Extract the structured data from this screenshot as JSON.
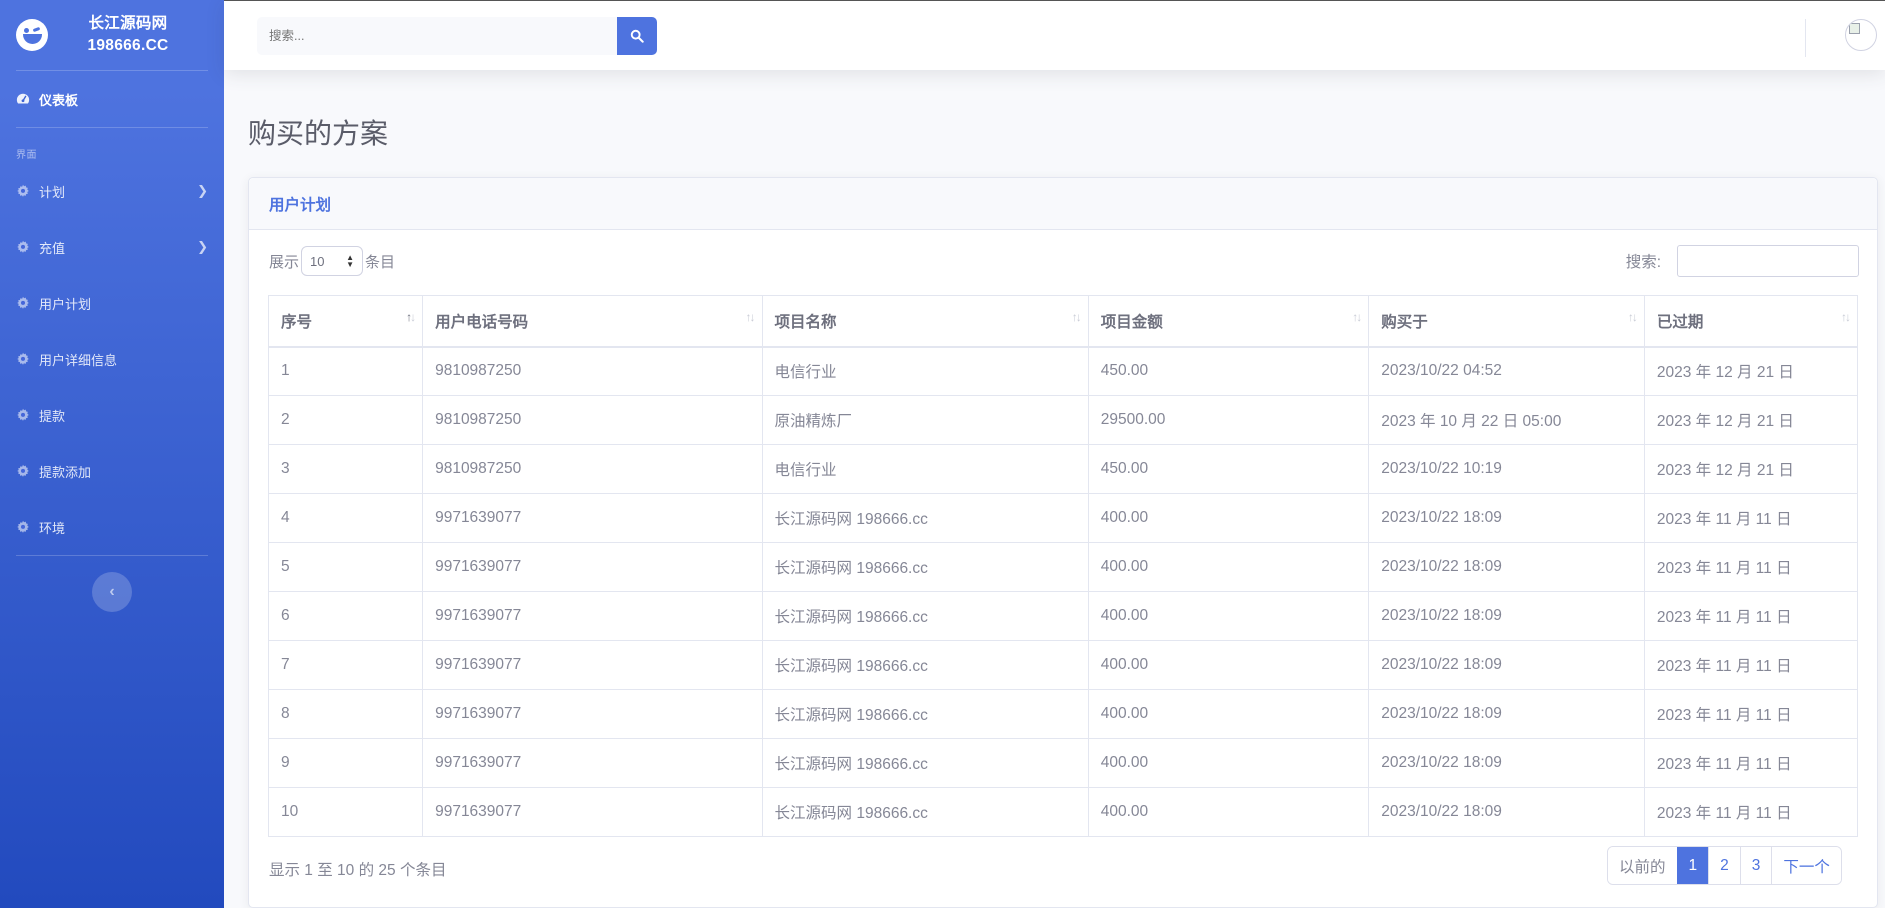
{
  "sidebar": {
    "brand_line1": "长江源码网",
    "brand_line2": "198666.CC",
    "dashboard": "仪表板",
    "heading": "界面",
    "items": [
      {
        "label": "计划",
        "icon": "gear-icon",
        "has_children": true
      },
      {
        "label": "充值",
        "icon": "gear-icon",
        "has_children": true
      },
      {
        "label": "用户计划",
        "icon": "gear-icon",
        "has_children": false
      },
      {
        "label": "用户详细信息",
        "icon": "gear-icon",
        "has_children": false
      },
      {
        "label": "提款",
        "icon": "gear-icon",
        "has_children": false
      },
      {
        "label": "提款添加",
        "icon": "gear-icon",
        "has_children": false
      },
      {
        "label": "环境",
        "icon": "gear-icon",
        "has_children": false
      }
    ],
    "toggle_glyph": "‹"
  },
  "topbar": {
    "search_placeholder": "搜索..."
  },
  "page": {
    "title": "购买的方案"
  },
  "card": {
    "header": "用户计划",
    "length_prefix": "展示",
    "length_value": "10",
    "length_suffix": "条目",
    "filter_label": "搜索:"
  },
  "table": {
    "columns": [
      "序号",
      "用户电话号码",
      "项目名称",
      "项目金额",
      "购买于",
      "已过期"
    ],
    "rows": [
      [
        "1",
        "9810987250",
        "电信行业",
        "450.00",
        "2023/10/22 04:52",
        "2023 年 12 月 21 日"
      ],
      [
        "2",
        "9810987250",
        "原油精炼厂",
        "29500.00",
        "2023 年 10 月 22 日 05:00",
        "2023 年 12 月 21 日"
      ],
      [
        "3",
        "9810987250",
        "电信行业",
        "450.00",
        "2023/10/22 10:19",
        "2023 年 12 月 21 日"
      ],
      [
        "4",
        "9971639077",
        "长江源码网 198666.cc",
        "400.00",
        "2023/10/22 18:09",
        "2023 年 11 月 11 日"
      ],
      [
        "5",
        "9971639077",
        "长江源码网 198666.cc",
        "400.00",
        "2023/10/22 18:09",
        "2023 年 11 月 11 日"
      ],
      [
        "6",
        "9971639077",
        "长江源码网 198666.cc",
        "400.00",
        "2023/10/22 18:09",
        "2023 年 11 月 11 日"
      ],
      [
        "7",
        "9971639077",
        "长江源码网 198666.cc",
        "400.00",
        "2023/10/22 18:09",
        "2023 年 11 月 11 日"
      ],
      [
        "8",
        "9971639077",
        "长江源码网 198666.cc",
        "400.00",
        "2023/10/22 18:09",
        "2023 年 11 月 11 日"
      ],
      [
        "9",
        "9971639077",
        "长江源码网 198666.cc",
        "400.00",
        "2023/10/22 18:09",
        "2023 年 11 月 11 日"
      ],
      [
        "10",
        "9971639077",
        "长江源码网 198666.cc",
        "400.00",
        "2023/10/22 18:09",
        "2023 年 11 月 11 日"
      ]
    ]
  },
  "footer": {
    "info": "显示 1 至 10 的 25 个条目",
    "prev": "以前的",
    "pages": [
      "1",
      "2",
      "3"
    ],
    "active_page": "1",
    "next": "下一个"
  },
  "colors": {
    "primary": "#4e73df",
    "sidebar_dark": "#224abe",
    "text_muted": "#858796"
  }
}
